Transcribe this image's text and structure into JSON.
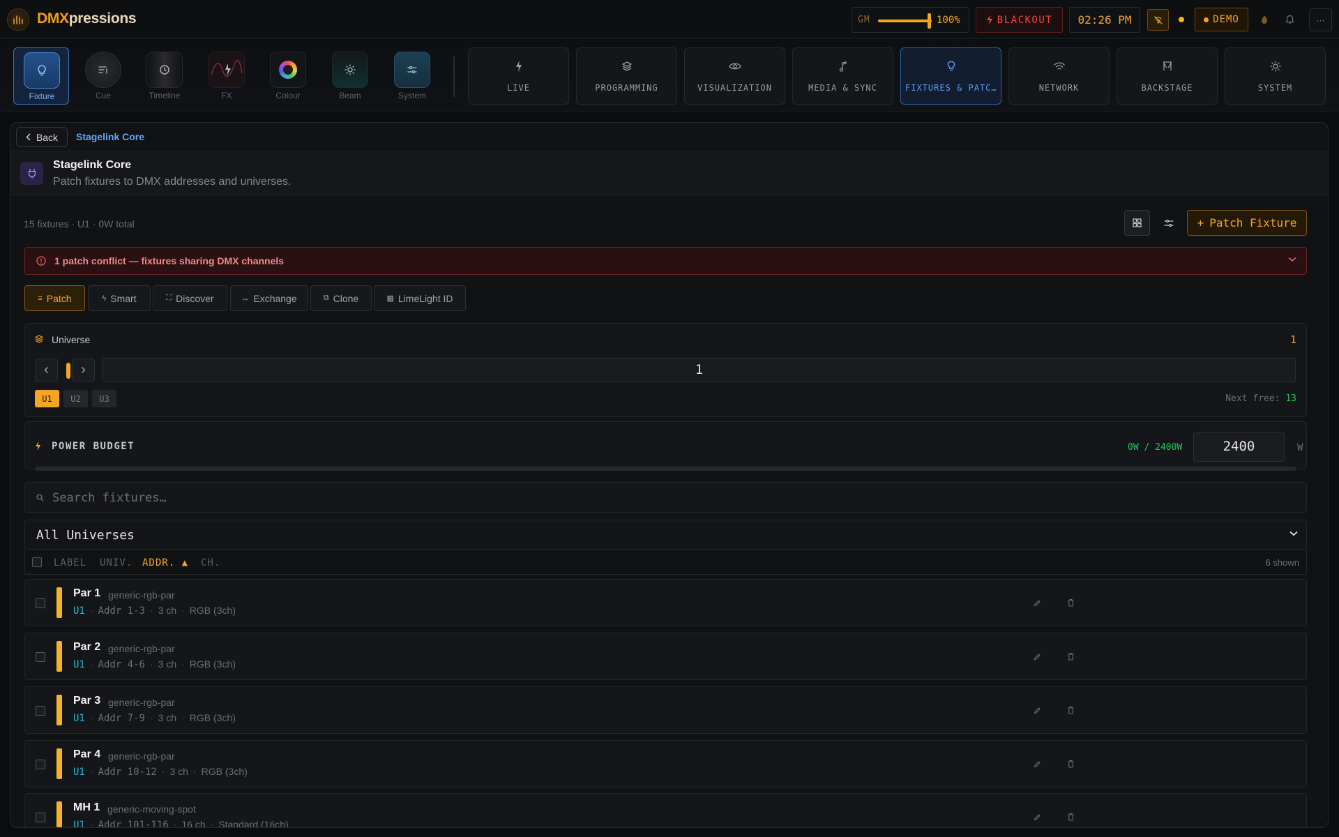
{
  "app": {
    "brand_a": "DMX",
    "brand_b": "pressions"
  },
  "topbar": {
    "gm_label": "GM",
    "gm_value": "100%",
    "gm_level": 1.0,
    "blackout_label": "BLACKOUT",
    "clock": "02:26 PM",
    "demo_label": "DEMO",
    "menu_label": "···"
  },
  "modes": [
    {
      "label": "Fixture"
    },
    {
      "label": "Cue"
    },
    {
      "label": "Timeline"
    },
    {
      "label": "FX"
    },
    {
      "label": "Colour"
    },
    {
      "label": "Beam"
    },
    {
      "label": "System"
    }
  ],
  "nav_tabs": [
    {
      "label": "LIVE"
    },
    {
      "label": "PROGRAMMING"
    },
    {
      "label": "VISUALIZATION"
    },
    {
      "label": "MEDIA & SYNC"
    },
    {
      "label": "FIXTURES & PATCH"
    },
    {
      "label": "NETWORK"
    },
    {
      "label": "BACKSTAGE"
    },
    {
      "label": "SYSTEM"
    }
  ],
  "panel": {
    "back_label": "Back",
    "breadcrumb": "Stagelink Core",
    "title": "Stagelink Core",
    "subtitle": "Patch fixtures to DMX addresses and universes.",
    "summary": "15 fixtures · U1 · 0W total",
    "patch_fixture_label": "Patch Fixture",
    "conflict_text": "1 patch conflict — fixtures sharing DMX channels",
    "subtabs": [
      {
        "label": "Patch",
        "icon": "≡"
      },
      {
        "label": "Smart",
        "icon": "ϟ"
      },
      {
        "label": "Discover",
        "icon": "⛶"
      },
      {
        "label": "Exchange",
        "icon": "↔"
      },
      {
        "label": "Clone",
        "icon": "⧉"
      },
      {
        "label": "LimeLight ID",
        "icon": "▦"
      }
    ],
    "universe": {
      "title": "Universe",
      "value": "1",
      "input_value": "1",
      "chips": [
        "U1",
        "U2",
        "U3"
      ],
      "next_free_label": "Next free:",
      "next_free_value": "13"
    },
    "power": {
      "title": "POWER BUDGET",
      "usage": "0W / 2400W",
      "input_value": "2400",
      "unit": "W",
      "usage_fraction": 0.0
    },
    "search_placeholder": "Search fixtures…",
    "universe_filter": "All Universes",
    "table": {
      "headers": [
        "LABEL",
        "UNIV.",
        "ADDR. ▲",
        "CH."
      ],
      "shown": "6 shown"
    },
    "fixtures": [
      {
        "name": "Par 1",
        "type": "generic-rgb-par",
        "univ": "U1",
        "addr": "Addr 1-3",
        "ch": "3 ch",
        "mode": "RGB (3ch)"
      },
      {
        "name": "Par 2",
        "type": "generic-rgb-par",
        "univ": "U1",
        "addr": "Addr 4-6",
        "ch": "3 ch",
        "mode": "RGB (3ch)"
      },
      {
        "name": "Par 3",
        "type": "generic-rgb-par",
        "univ": "U1",
        "addr": "Addr 7-9",
        "ch": "3 ch",
        "mode": "RGB (3ch)"
      },
      {
        "name": "Par 4",
        "type": "generic-rgb-par",
        "univ": "U1",
        "addr": "Addr 10-12",
        "ch": "3 ch",
        "mode": "RGB (3ch)"
      },
      {
        "name": "MH 1",
        "type": "generic-moving-spot",
        "univ": "U1",
        "addr": "Addr 101-116",
        "ch": "16 ch",
        "mode": "Standard (16ch)"
      }
    ]
  }
}
